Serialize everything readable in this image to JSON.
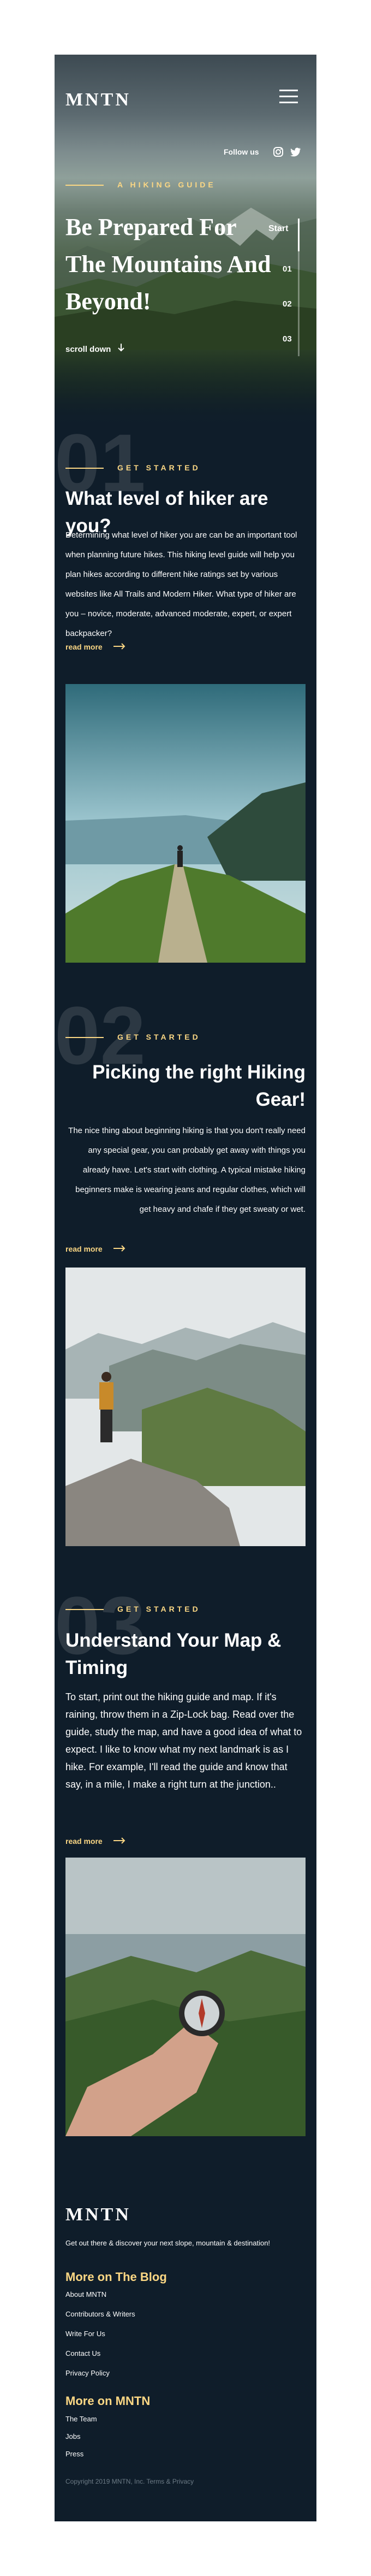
{
  "header": {
    "logo": "MNTN",
    "follow_label": "Follow us"
  },
  "hero": {
    "eyebrow": "A HIKING GUIDE",
    "title": "Be Prepared For The Mountains And Beyond!",
    "scroll_label": "scroll down",
    "nav": {
      "start": "Start",
      "items": [
        "01",
        "02",
        "03"
      ]
    }
  },
  "sections": [
    {
      "number": "01",
      "tag": "GET STARTED",
      "title": "What level of  hiker are you?",
      "body": "Determining what level of hiker you are can be an important tool when planning future hikes. This hiking level guide will help you plan hikes according to different hike ratings set by various websites like All Trails and Modern Hiker. What type of hiker are you – novice, moderate, advanced moderate, expert, or expert backpacker?",
      "read_more": "read more"
    },
    {
      "number": "02",
      "tag": "GET STARTED",
      "title": "Picking the right Hiking Gear!",
      "body": "The nice thing about beginning hiking is that you don't really need any special gear, you can probably get away with things you already have. Let's start with clothing. A typical mistake hiking beginners make is wearing jeans and regular clothes, which will get heavy and chafe if they get sweaty or wet.",
      "read_more": "read more"
    },
    {
      "number": "03",
      "tag": "GET STARTED",
      "title": "Understand Your Map & Timing",
      "body": "To start, print out the hiking guide and map. If it's raining, throw them in a Zip-Lock bag. Read over the guide, study the map, and have a good idea of what to expect. I like to know what my next landmark is as I hike. For example, I'll read the guide and know that say, in a mile, I make a right turn at the junction..",
      "read_more": "read more"
    }
  ],
  "footer": {
    "logo": "MNTN",
    "tagline": "Get out there & discover your next slope, mountain & destination!",
    "blog_heading": "More on The Blog",
    "blog_links": [
      "About MNTN",
      "Contributors & Writers",
      "Write For Us",
      "Contact Us",
      "Privacy Policy"
    ],
    "mntn_heading": "More on MNTN",
    "mntn_links": [
      "The Team",
      "Jobs",
      "Press"
    ],
    "copyright": "Copyright 2019 MNTN, Inc. Terms & Privacy"
  },
  "icons": {
    "menu": "hamburger-menu-icon",
    "instagram": "instagram-icon",
    "twitter": "twitter-icon",
    "scroll_arrow": "arrow-down-icon",
    "read_more_arrow": "arrow-right-icon"
  },
  "colors": {
    "background": "#0f1d2a",
    "accent": "#fbd784",
    "text": "#ffffff"
  }
}
